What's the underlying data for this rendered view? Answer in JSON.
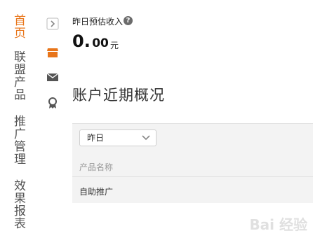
{
  "nav": {
    "items": [
      {
        "label": "首页",
        "active": true
      },
      {
        "label": "联盟产品",
        "active": false
      },
      {
        "label": "推广管理",
        "active": false
      },
      {
        "label": "效果报表",
        "active": false
      }
    ]
  },
  "icons": [
    "expand-arrow-icon",
    "storefront-icon",
    "mail-icon",
    "award-icon"
  ],
  "colors": {
    "accent": "#e8751a",
    "text": "#333333",
    "panel_bg": "#f3f3f3"
  },
  "metric": {
    "label": "昨日预估收入",
    "help": "?",
    "value_int": "0.",
    "value_dec": "00",
    "unit": "元"
  },
  "section": {
    "title": "账户近期概况"
  },
  "panel": {
    "date_select": {
      "value": "昨日"
    },
    "column_header": "产品名称",
    "rows": [
      "自助推广"
    ]
  },
  "watermark": "Bai 经验"
}
